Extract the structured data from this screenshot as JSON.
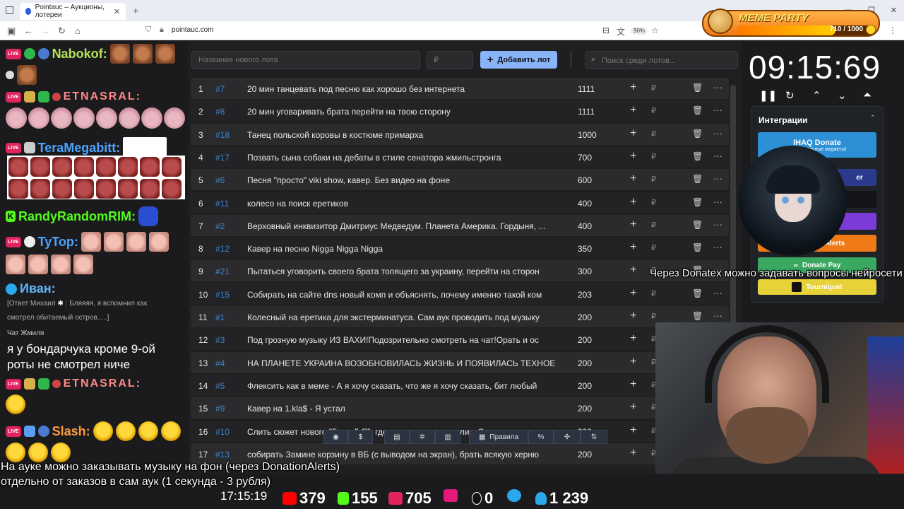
{
  "browser": {
    "tab_title": "Pointauc – Аукционы, лотереи",
    "url": "pointauc.com",
    "zoom": "90%"
  },
  "meme_party": {
    "title": "MEME PARTY",
    "count": "710 / 1000",
    "progress": 0.71
  },
  "chat": {
    "messages": [
      {
        "user": "Nabokof:"
      },
      {
        "user": "ЕТNASRAL:"
      },
      {
        "user": "TeraMegabitt:"
      },
      {
        "user": "RandyRandomRIM:"
      },
      {
        "user": "TyTop:"
      },
      {
        "user": "Иван:"
      },
      {
        "user": "ЕТNASRAL:"
      },
      {
        "user": "Slash:"
      }
    ],
    "reply": "[Ответ Михаил",
    "reply_text": ": Бляяяя, я вспомнил как",
    "reply_text2": "смотрел обитаемый остров.....]",
    "label_zhmilya": "Чат Жмиля",
    "big_text_1": "я у бондарчука кроме 9-ой",
    "big_text_2": "роты не смотрел ниче"
  },
  "auction": {
    "new_lot_placeholder": "Название нового лота",
    "amount_placeholder": "₽",
    "add_label": "Добавить лот",
    "search_placeholder": "Поиск среди лотов...",
    "currency": "₽",
    "lots": [
      {
        "idx": "1",
        "num": "#7",
        "name": "20 мин танцевать под песню как хорошо без интернета",
        "amount": "1111"
      },
      {
        "idx": "2",
        "num": "#8",
        "name": "20 мин уговаривать брата перейти на твою сторону",
        "amount": "1111"
      },
      {
        "idx": "3",
        "num": "#18",
        "name": "Танец польской коровы в костюме примарха",
        "amount": "1000"
      },
      {
        "idx": "4",
        "num": "#17",
        "name": "Позвать сына собаки на дебаты в стиле сенатора жмильстронга",
        "amount": "700"
      },
      {
        "idx": "5",
        "num": "#6",
        "name": "Песня \"просто\" viki show, кавер. Без видео на фоне",
        "amount": "600"
      },
      {
        "idx": "6",
        "num": "#11",
        "name": "колесо на поиск еретиков",
        "amount": "400"
      },
      {
        "idx": "7",
        "num": "#2",
        "name": "Верховный инквизитор Дмитриус Медведум. Планета Америка. Гордыня, ...",
        "amount": "400"
      },
      {
        "idx": "8",
        "num": "#12",
        "name": "Кавер на песню Nigga Nigga Nigga",
        "amount": "350"
      },
      {
        "idx": "9",
        "num": "#21",
        "name": "Пытаться уговорить своего брата топящего за украину, перейти на сторон",
        "amount": "300"
      },
      {
        "idx": "10",
        "num": "#15",
        "name": "Собирать на сайте dns новый комп и объяснять, почему именно такой ком",
        "amount": "203"
      },
      {
        "idx": "11",
        "num": "#1",
        "name": "Колесный на еретика для экстерминатуса. Сам аук проводить под музыку",
        "amount": "200"
      },
      {
        "idx": "12",
        "num": "#3",
        "name": "Под грозную музыку ИЗ ВАХИ!Подозрительно смотреть на чат!Орать и ос",
        "amount": "200"
      },
      {
        "idx": "13",
        "num": "#4",
        "name": "НА ПЛАНЕТЕ УКРАИНА ВОЗОБНОВИЛАСЬ ЖИЗНЬ И ПОЯВИЛАСЬ ТЕХНОЕ",
        "amount": "200"
      },
      {
        "idx": "14",
        "num": "#5",
        "name": "Флексить как в меме - А я хочу сказать, что же я хочу сказать, бит любый",
        "amount": "200"
      },
      {
        "idx": "15",
        "num": "#9",
        "name": "Кавер на 1.kla$ - Я устал",
        "amount": "200"
      },
      {
        "idx": "16",
        "num": "#10",
        "name": "Слить сюжет нового \"Гадкий Я\", где миньоны примкнули к Свинцову и нач",
        "amount": "200"
      },
      {
        "idx": "17",
        "num": "#13",
        "name": "собирать Замине корзину в ВБ (с выводом на экран), брать всякую херню",
        "amount": "200"
      }
    ],
    "toolbar": {
      "github": "⌥",
      "dollar": "$",
      "rules": "Правила",
      "percent": "%"
    }
  },
  "timer": {
    "value": "09:15:69"
  },
  "integrations": {
    "title": "Интеграции",
    "items": [
      {
        "label": "IHAQ Donate",
        "color": "#2d8fd5"
      },
      {
        "label": "er",
        "color": "#2b3a8c"
      },
      {
        "label": "",
        "color": "#15121a"
      },
      {
        "label": "",
        "color": "#7c3ad6"
      },
      {
        "label": "Alerts",
        "color": "#f07a16"
      },
      {
        "label": "Donate Pay",
        "color": "#3aa860"
      },
      {
        "label": "Tourniquet",
        "color": "#e8d23a"
      }
    ]
  },
  "overlay": {
    "donatex": "Через Donatex можно задавать вопросы нейросети",
    "music_1": "На ауке можно заказывать музыку на фон (через DonationAlerts)",
    "music_2": "отдельно от заказов в сам аук (1 секунда - 3 рубля)"
  },
  "status": {
    "clock": "17:15:19",
    "youtube": "379",
    "kick": "155",
    "live": "705",
    "rutube": "0",
    "telegram": "",
    "viewers": "1 239"
  },
  "colors": {
    "accent": "#8ab4f8",
    "lot_number": "#3b82c8"
  }
}
